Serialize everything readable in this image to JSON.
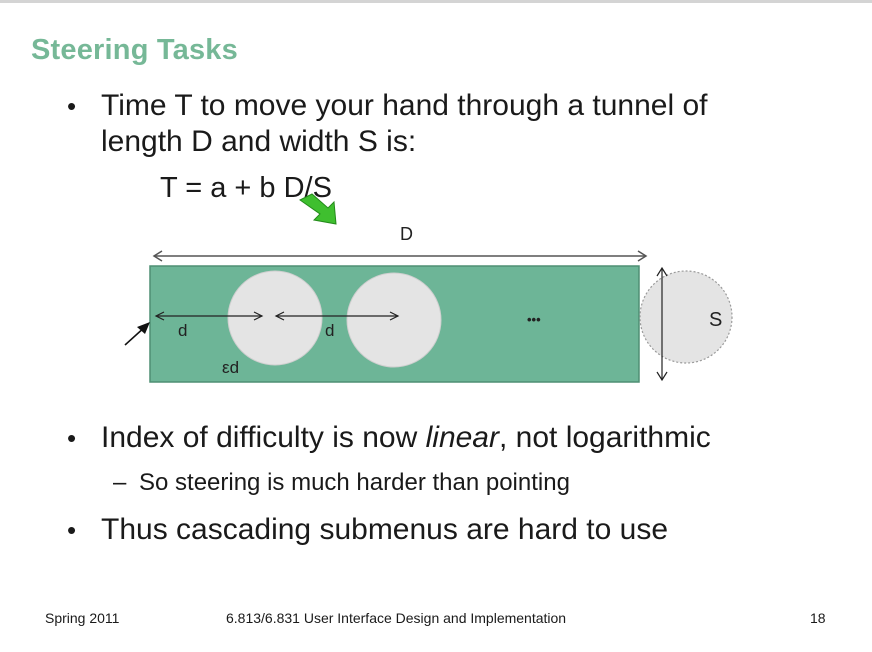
{
  "slide": {
    "title": "Steering Tasks",
    "bullet1_line1": "Time T to move your hand through a tunnel of",
    "bullet1_line2": "length D and width S is:",
    "formula": "T = a + b D/S",
    "bullet2_pre": "Index of difficulty is now ",
    "bullet2_em": "linear",
    "bullet2_post": ", not logarithmic",
    "sub_bullet": "So steering is much harder than pointing",
    "bullet3": "Thus cascading submenus are hard to use",
    "bullet_glyph": "•",
    "dash_glyph": "–"
  },
  "diagram": {
    "label_D": "D",
    "label_S": "S",
    "label_d1": "d",
    "label_d2": "d",
    "label_ed": "εd",
    "ellipsis": "•••",
    "tunnel_color": "#6db597",
    "circle_color": "#e4e4e4",
    "pointer_color": "#3fbf2f"
  },
  "footer": {
    "left": "Spring 2011",
    "center": "6.813/6.831 User Interface Design and Implementation",
    "page": "18"
  }
}
